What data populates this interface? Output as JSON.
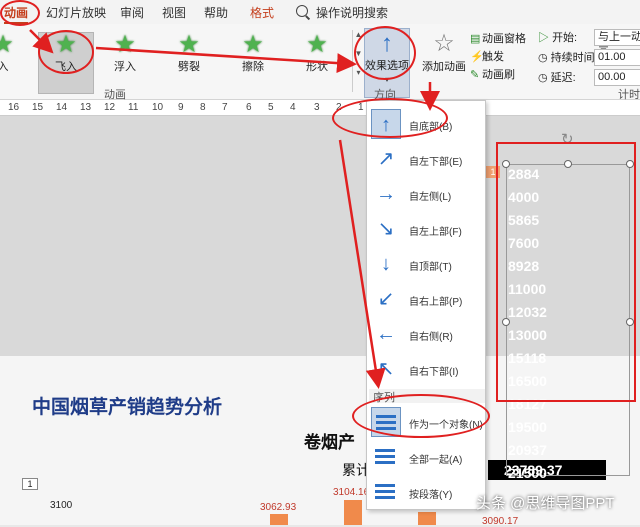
{
  "tabs": [
    {
      "label": "动画",
      "active": true
    },
    {
      "label": "幻灯片放映"
    },
    {
      "label": "审阅"
    },
    {
      "label": "视图"
    },
    {
      "label": "帮助"
    },
    {
      "label": "格式",
      "format": true
    }
  ],
  "search_label": "操作说明搜索",
  "animations": [
    {
      "label": "飞入",
      "selected": true
    },
    {
      "label": "浮入"
    },
    {
      "label": "劈裂"
    },
    {
      "label": "擦除"
    },
    {
      "label": "形状"
    }
  ],
  "effect_options_label": "效果选项",
  "add_animation_label": "添加动画",
  "small_cmds": [
    "动画窗格",
    "触发",
    "动画刷"
  ],
  "timing": {
    "start_label": "开始:",
    "start_value": "与上一动画...",
    "duration_label": "持续时间:",
    "duration_value": "01.00",
    "delay_label": "延迟:",
    "delay_value": "00.00"
  },
  "group_labels": {
    "animation": "动画",
    "direction": "方向",
    "timing": "计时"
  },
  "ruler": [
    "16",
    "15",
    "14",
    "13",
    "12",
    "11",
    "10",
    "9",
    "8",
    "7",
    "6",
    "5",
    "4",
    "3",
    "2",
    "1"
  ],
  "direction_menu": [
    {
      "label": "自底部(B)",
      "icon": "arrow-up",
      "selected": true
    },
    {
      "label": "自左下部(E)",
      "icon": "arrow-up-right"
    },
    {
      "label": "自左侧(L)",
      "icon": "arrow-right"
    },
    {
      "label": "自左上部(F)",
      "icon": "arrow-down-right"
    },
    {
      "label": "自顶部(T)",
      "icon": "arrow-down"
    },
    {
      "label": "自右上部(P)",
      "icon": "arrow-down-left"
    },
    {
      "label": "自右侧(R)",
      "icon": "arrow-left"
    },
    {
      "label": "自右下部(I)",
      "icon": "arrow-up-left"
    }
  ],
  "sequence_header": "序列",
  "sequence_menu": [
    {
      "label": "作为一个对象(N)",
      "selected": true
    },
    {
      "label": "全部一起(A)"
    },
    {
      "label": "按段落(Y)"
    }
  ],
  "slide": {
    "title": "中国烟草产销趋势分析",
    "subtitle_left": "卷烟产",
    "subtitle_right": "）",
    "cumulative_label": "累计",
    "cumulative_value": "23789.37",
    "axis_value": "3100",
    "bar_values": [
      "3062.93",
      "3104.16",
      "3090.17"
    ],
    "slide_num": "1",
    "badge_num": "1"
  },
  "column_numbers": [
    "2884",
    "4000",
    "5865",
    "7600",
    "8928",
    "11000",
    "12032",
    "13000",
    "15118",
    "16500",
    "18127",
    "19500",
    "20937",
    "21500"
  ],
  "watermark": "头条 @思维导图PPT",
  "colors": {
    "accent": "#c43e1c",
    "annotation": "#e02020",
    "slide_title": "#1f3c88",
    "bar": "#f08a4b"
  }
}
